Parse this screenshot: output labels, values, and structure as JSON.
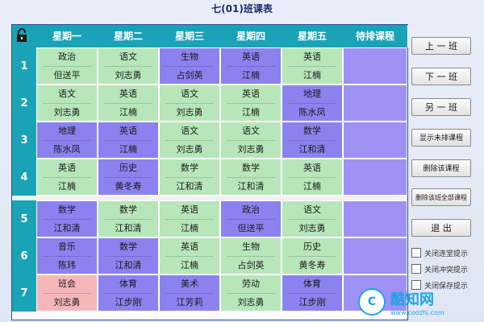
{
  "window": {
    "title": "七(01)班课表"
  },
  "columns": [
    "星期一",
    "星期二",
    "星期三",
    "星期四",
    "星期五",
    "待排课程"
  ],
  "rows": [
    {
      "num": "1",
      "cells": [
        {
          "subject": "政治",
          "teacher": "但送平",
          "color": "green"
        },
        {
          "subject": "语文",
          "teacher": "刘志勇",
          "color": "green"
        },
        {
          "subject": "生物",
          "teacher": "占剑英",
          "color": "purple"
        },
        {
          "subject": "英语",
          "teacher": "江楠",
          "color": "purple"
        },
        {
          "subject": "英语",
          "teacher": "江楠",
          "color": "green"
        },
        {
          "subject": "",
          "teacher": "",
          "color": "lav"
        }
      ]
    },
    {
      "num": "2",
      "cells": [
        {
          "subject": "语文",
          "teacher": "刘志勇",
          "color": "green"
        },
        {
          "subject": "英语",
          "teacher": "江楠",
          "color": "green"
        },
        {
          "subject": "语文",
          "teacher": "刘志勇",
          "color": "green"
        },
        {
          "subject": "英语",
          "teacher": "江楠",
          "color": "green"
        },
        {
          "subject": "地理",
          "teacher": "陈水凤",
          "color": "purple"
        },
        {
          "subject": "",
          "teacher": "",
          "color": "lav"
        }
      ]
    },
    {
      "num": "3",
      "cells": [
        {
          "subject": "地理",
          "teacher": "陈水凤",
          "color": "purple"
        },
        {
          "subject": "英语",
          "teacher": "江楠",
          "color": "purple"
        },
        {
          "subject": "语文",
          "teacher": "刘志勇",
          "color": "green"
        },
        {
          "subject": "语文",
          "teacher": "刘志勇",
          "color": "green"
        },
        {
          "subject": "数学",
          "teacher": "江和清",
          "color": "purple"
        },
        {
          "subject": "",
          "teacher": "",
          "color": "lav"
        }
      ]
    },
    {
      "num": "4",
      "cells": [
        {
          "subject": "英语",
          "teacher": "江楠",
          "color": "green"
        },
        {
          "subject": "历史",
          "teacher": "黄冬寿",
          "color": "purple"
        },
        {
          "subject": "数学",
          "teacher": "江和清",
          "color": "green"
        },
        {
          "subject": "数学",
          "teacher": "江和清",
          "color": "green"
        },
        {
          "subject": "英语",
          "teacher": "江楠",
          "color": "green"
        },
        {
          "subject": "",
          "teacher": "",
          "color": "lav"
        }
      ]
    },
    {
      "num": "5",
      "cells": [
        {
          "subject": "数学",
          "teacher": "江和清",
          "color": "purple"
        },
        {
          "subject": "数学",
          "teacher": "江和清",
          "color": "green"
        },
        {
          "subject": "英语",
          "teacher": "江楠",
          "color": "green"
        },
        {
          "subject": "政治",
          "teacher": "但送平",
          "color": "purple"
        },
        {
          "subject": "语文",
          "teacher": "刘志勇",
          "color": "green"
        },
        {
          "subject": "",
          "teacher": "",
          "color": "lav"
        }
      ]
    },
    {
      "num": "6",
      "cells": [
        {
          "subject": "音乐",
          "teacher": "陈玮",
          "color": "purple"
        },
        {
          "subject": "数学",
          "teacher": "江和清",
          "color": "purple"
        },
        {
          "subject": "英语",
          "teacher": "江楠",
          "color": "green"
        },
        {
          "subject": "生物",
          "teacher": "占剑英",
          "color": "green"
        },
        {
          "subject": "历史",
          "teacher": "黄冬寿",
          "color": "green"
        },
        {
          "subject": "",
          "teacher": "",
          "color": "lav"
        }
      ]
    },
    {
      "num": "7",
      "cells": [
        {
          "subject": "班会",
          "teacher": "刘志勇",
          "color": "pink"
        },
        {
          "subject": "体育",
          "teacher": "江步刚",
          "color": "purple"
        },
        {
          "subject": "美术",
          "teacher": "江芳莉",
          "color": "purple"
        },
        {
          "subject": "劳动",
          "teacher": "刘志勇",
          "color": "green"
        },
        {
          "subject": "体育",
          "teacher": "江步刚",
          "color": "purple"
        },
        {
          "subject": "",
          "teacher": "",
          "color": "lav"
        }
      ]
    }
  ],
  "buttons": {
    "prev_class": "上 一 班",
    "next_class": "下 一 班",
    "other_class": "另 一 班",
    "show_unscheduled": "显示未排课程",
    "delete_course": "删除该课程",
    "delete_all": "删除该班全部课程",
    "exit": "退 出"
  },
  "checkboxes": [
    "关闭连堂提示",
    "关闭冲突提示",
    "关闭保存提示"
  ],
  "watermark": {
    "name": "酷知网",
    "url": "www.coozhi.com"
  }
}
